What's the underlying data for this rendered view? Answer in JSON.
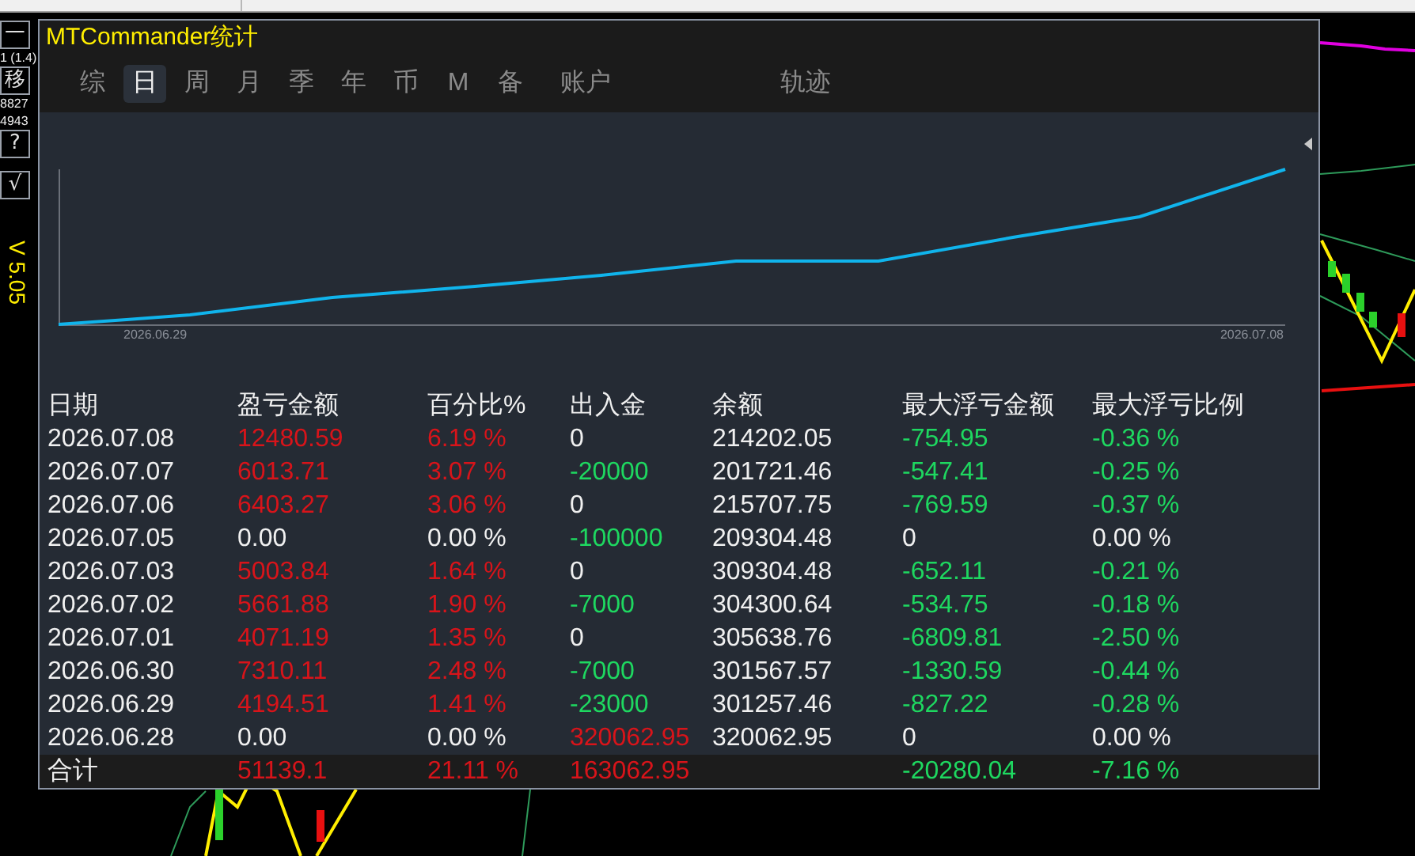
{
  "side_toolbar": {
    "buttons": [
      "一",
      "移",
      "?",
      "√"
    ],
    "labels": [
      "1 (1.4)",
      "8827",
      "4943"
    ],
    "version": "V 5.05"
  },
  "window": {
    "title": "MTCommander统计"
  },
  "tabs": [
    {
      "label": "综",
      "selected": false
    },
    {
      "label": "日",
      "selected": true
    },
    {
      "label": "周",
      "selected": false
    },
    {
      "label": "月",
      "selected": false
    },
    {
      "label": "季",
      "selected": false
    },
    {
      "label": "年",
      "selected": false
    },
    {
      "label": "币",
      "selected": false
    },
    {
      "label": "M",
      "selected": false
    },
    {
      "label": "备",
      "selected": false
    },
    {
      "label": "账户",
      "selected": false
    },
    {
      "label": "轨迹",
      "selected": false
    }
  ],
  "chart": {
    "start_label": "2026.06.29",
    "end_label": "2026.07.08"
  },
  "table": {
    "columns": [
      "日期",
      "盈亏金额",
      "百分比%",
      "出入金",
      "余额",
      "最大浮亏金额",
      "最大浮亏比例"
    ],
    "rows": [
      [
        {
          "text": "2026.07.08",
          "color": "#f0f0f0"
        },
        {
          "text": "12480.59",
          "color": "#d8141a"
        },
        {
          "text": "6.19 %",
          "color": "#d8141a"
        },
        {
          "text": "0",
          "color": "#f0f0f0"
        },
        {
          "text": "214202.05",
          "color": "#f0f0f0"
        },
        {
          "text": "-754.95",
          "color": "#1ed860"
        },
        {
          "text": "-0.36 %",
          "color": "#1ed860"
        }
      ],
      [
        {
          "text": "2026.07.07",
          "color": "#f0f0f0"
        },
        {
          "text": "6013.71",
          "color": "#d8141a"
        },
        {
          "text": "3.07 %",
          "color": "#d8141a"
        },
        {
          "text": "-20000",
          "color": "#1ed860"
        },
        {
          "text": "201721.46",
          "color": "#f0f0f0"
        },
        {
          "text": "-547.41",
          "color": "#1ed860"
        },
        {
          "text": "-0.25 %",
          "color": "#1ed860"
        }
      ],
      [
        {
          "text": "2026.07.06",
          "color": "#f0f0f0"
        },
        {
          "text": "6403.27",
          "color": "#d8141a"
        },
        {
          "text": "3.06 %",
          "color": "#d8141a"
        },
        {
          "text": "0",
          "color": "#f0f0f0"
        },
        {
          "text": "215707.75",
          "color": "#f0f0f0"
        },
        {
          "text": "-769.59",
          "color": "#1ed860"
        },
        {
          "text": "-0.37 %",
          "color": "#1ed860"
        }
      ],
      [
        {
          "text": "2026.07.05",
          "color": "#f0f0f0"
        },
        {
          "text": "0.00",
          "color": "#f0f0f0"
        },
        {
          "text": "0.00 %",
          "color": "#f0f0f0"
        },
        {
          "text": "-100000",
          "color": "#1ed860"
        },
        {
          "text": "209304.48",
          "color": "#f0f0f0"
        },
        {
          "text": "0",
          "color": "#f0f0f0"
        },
        {
          "text": "0.00 %",
          "color": "#f0f0f0"
        }
      ],
      [
        {
          "text": "2026.07.03",
          "color": "#f0f0f0"
        },
        {
          "text": "5003.84",
          "color": "#d8141a"
        },
        {
          "text": "1.64 %",
          "color": "#d8141a"
        },
        {
          "text": "0",
          "color": "#f0f0f0"
        },
        {
          "text": "309304.48",
          "color": "#f0f0f0"
        },
        {
          "text": "-652.11",
          "color": "#1ed860"
        },
        {
          "text": "-0.21 %",
          "color": "#1ed860"
        }
      ],
      [
        {
          "text": "2026.07.02",
          "color": "#f0f0f0"
        },
        {
          "text": "5661.88",
          "color": "#d8141a"
        },
        {
          "text": "1.90 %",
          "color": "#d8141a"
        },
        {
          "text": "-7000",
          "color": "#1ed860"
        },
        {
          "text": "304300.64",
          "color": "#f0f0f0"
        },
        {
          "text": "-534.75",
          "color": "#1ed860"
        },
        {
          "text": "-0.18 %",
          "color": "#1ed860"
        }
      ],
      [
        {
          "text": "2026.07.01",
          "color": "#f0f0f0"
        },
        {
          "text": "4071.19",
          "color": "#d8141a"
        },
        {
          "text": "1.35 %",
          "color": "#d8141a"
        },
        {
          "text": "0",
          "color": "#f0f0f0"
        },
        {
          "text": "305638.76",
          "color": "#f0f0f0"
        },
        {
          "text": "-6809.81",
          "color": "#1ed860"
        },
        {
          "text": "-2.50 %",
          "color": "#1ed860"
        }
      ],
      [
        {
          "text": "2026.06.30",
          "color": "#f0f0f0"
        },
        {
          "text": "7310.11",
          "color": "#d8141a"
        },
        {
          "text": "2.48 %",
          "color": "#d8141a"
        },
        {
          "text": "-7000",
          "color": "#1ed860"
        },
        {
          "text": "301567.57",
          "color": "#f0f0f0"
        },
        {
          "text": "-1330.59",
          "color": "#1ed860"
        },
        {
          "text": "-0.44 %",
          "color": "#1ed860"
        }
      ],
      [
        {
          "text": "2026.06.29",
          "color": "#f0f0f0"
        },
        {
          "text": "4194.51",
          "color": "#d8141a"
        },
        {
          "text": "1.41 %",
          "color": "#d8141a"
        },
        {
          "text": "-23000",
          "color": "#1ed860"
        },
        {
          "text": "301257.46",
          "color": "#f0f0f0"
        },
        {
          "text": "-827.22",
          "color": "#1ed860"
        },
        {
          "text": "-0.28 %",
          "color": "#1ed860"
        }
      ],
      [
        {
          "text": "2026.06.28",
          "color": "#f0f0f0"
        },
        {
          "text": "0.00",
          "color": "#f0f0f0"
        },
        {
          "text": "0.00 %",
          "color": "#f0f0f0"
        },
        {
          "text": "320062.95",
          "color": "#d8141a"
        },
        {
          "text": "320062.95",
          "color": "#f0f0f0"
        },
        {
          "text": "0",
          "color": "#f0f0f0"
        },
        {
          "text": "0.00 %",
          "color": "#f0f0f0"
        }
      ]
    ],
    "total": {
      "label": {
        "text": "合计",
        "color": "#f0f0f0"
      },
      "profit": {
        "text": "51139.1",
        "color": "#d8141a"
      },
      "percent": {
        "text": "21.11 %",
        "color": "#d8141a"
      },
      "deposit": {
        "text": "163062.95",
        "color": "#d8141a"
      },
      "max_loss": {
        "text": "-20280.04",
        "color": "#1ed860"
      },
      "max_loss_ratio": {
        "text": "-7.16 %",
        "color": "#1ed860"
      }
    }
  }
}
